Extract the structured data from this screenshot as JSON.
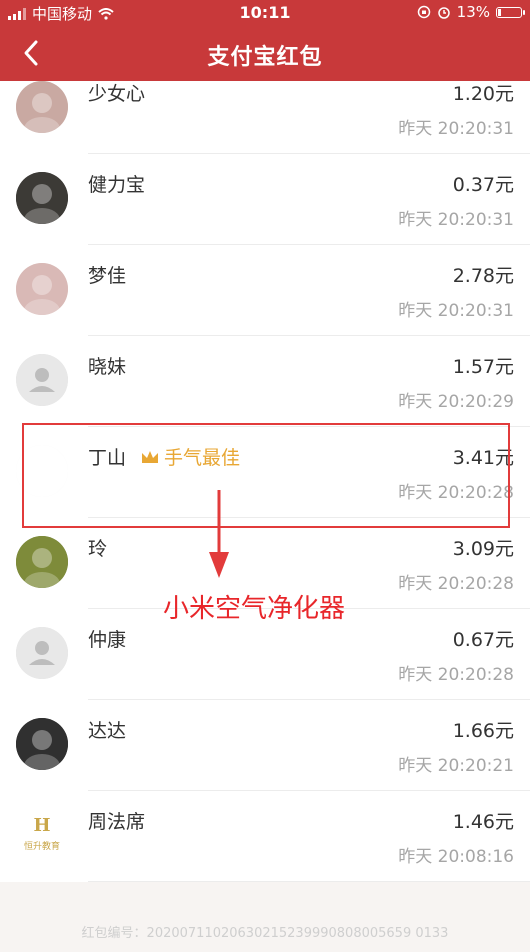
{
  "status_bar": {
    "carrier": "中国移动",
    "time": "10:11",
    "battery": "13%",
    "battery_level": 0.13
  },
  "nav": {
    "title": "支付宝红包"
  },
  "rows": [
    {
      "name": "少女心",
      "amount": "1.20元",
      "time": "昨天 20:20:31",
      "avatar": "photo"
    },
    {
      "name": "健力宝",
      "amount": "0.37元",
      "time": "昨天 20:20:31",
      "avatar": "photo"
    },
    {
      "name": "梦佳",
      "amount": "2.78元",
      "time": "昨天 20:20:31",
      "avatar": "photo"
    },
    {
      "name": "晓妹",
      "amount": "1.57元",
      "time": "昨天 20:20:29",
      "avatar": "default"
    },
    {
      "name": "丁山",
      "amount": "3.41元",
      "time": "昨天 20:20:28",
      "avatar": "photo",
      "badge": "手气最佳"
    },
    {
      "name": "玲",
      "amount": "3.09元",
      "time": "昨天 20:20:28",
      "avatar": "photo"
    },
    {
      "name": "仲康",
      "amount": "0.67元",
      "time": "昨天 20:20:28",
      "avatar": "default"
    },
    {
      "name": "达达",
      "amount": "1.66元",
      "time": "昨天 20:20:21",
      "avatar": "photo"
    },
    {
      "name": "周法席",
      "amount": "1.46元",
      "time": "昨天 20:08:16",
      "avatar": "logo",
      "logo_text": "恒升教育"
    }
  ],
  "annotation": {
    "text": "小米空气净化器"
  },
  "footer": {
    "order_no": "红包编号：20200711020630215239990808005659 0133"
  },
  "colors": {
    "header": "#c8393a",
    "badge": "#e8a734",
    "annotation": "#e8262a"
  },
  "icons": {
    "back": "chevron-left-icon",
    "crown": "crown-icon",
    "default_avatar": "person-icon"
  }
}
